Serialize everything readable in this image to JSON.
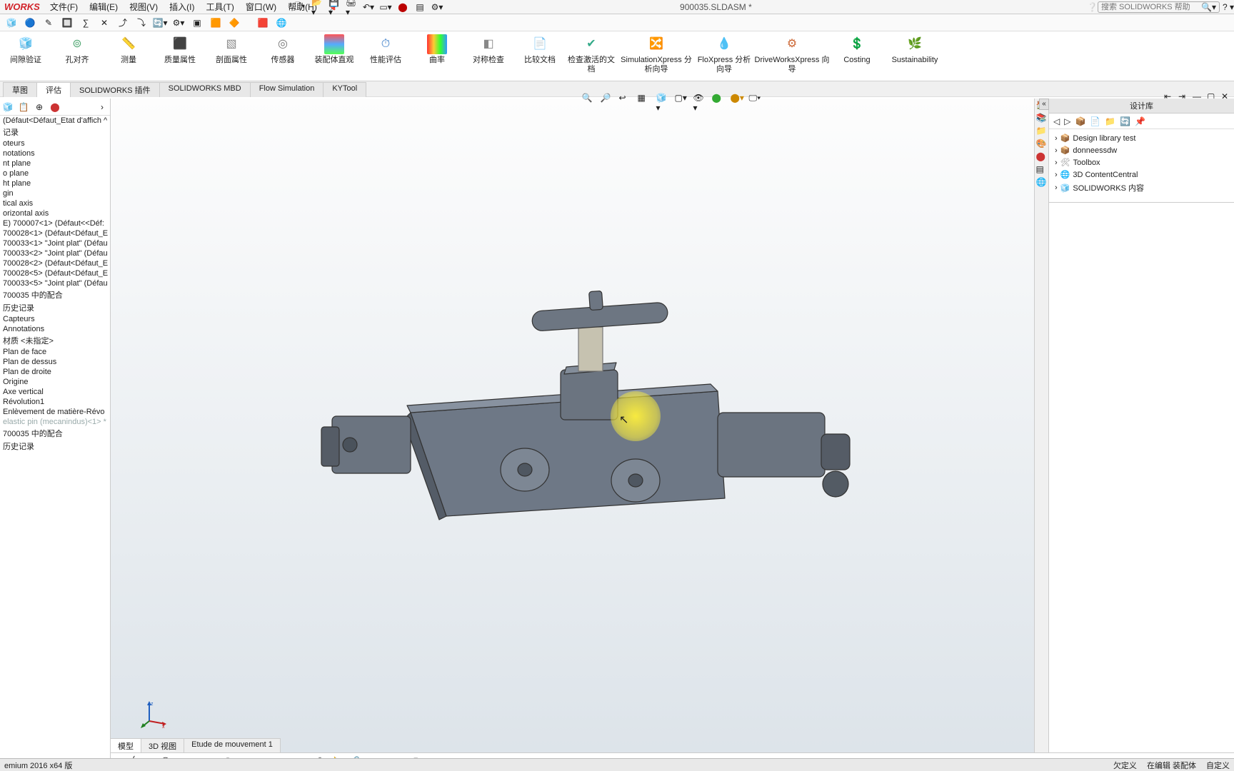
{
  "brand": "WORKS",
  "menus": [
    "文件(F)",
    "编辑(E)",
    "视图(V)",
    "插入(I)",
    "工具(T)",
    "窗口(W)",
    "帮助(H)"
  ],
  "doc_title": "900035.SLDASM *",
  "search_placeholder": "搜索 SOLIDWORKS 帮助",
  "ribbon": [
    {
      "label": "间隙验证"
    },
    {
      "label": "孔对齐"
    },
    {
      "label": "测量"
    },
    {
      "label": "质量属性"
    },
    {
      "label": "剖面属性"
    },
    {
      "label": "传感器"
    },
    {
      "label": "装配体直观"
    },
    {
      "label": "性能评估"
    },
    {
      "label": "曲率"
    },
    {
      "label": "对称检查"
    },
    {
      "label": "比较文档"
    },
    {
      "label": "检查激活的文档"
    },
    {
      "label": "SimulationXpress 分析向导"
    },
    {
      "label": "FloXpress 分析向导"
    },
    {
      "label": "DriveWorksXpress 向导"
    },
    {
      "label": "Costing"
    },
    {
      "label": "Sustainability"
    }
  ],
  "cmd_tabs": [
    "草图",
    "评估",
    "SOLIDWORKS 插件",
    "SOLIDWORKS MBD",
    "Flow Simulation",
    "KYTool"
  ],
  "feature_tree": [
    "(Défaut<Défaut_Etat d'affich ^",
    "记录",
    "oteurs",
    "notations",
    "nt plane",
    "o plane",
    "ht plane",
    "gin",
    "tical axis",
    "orizontal axis",
    "E) 700007<1> (Défaut<<Déf:",
    "700028<1> (Défaut<Défaut_E",
    "700033<1> \"Joint plat\" (Défau",
    "700033<2> \"Joint plat\" (Défau",
    "700028<2> (Défaut<Défaut_E",
    "700028<5> (Défaut<Défaut_E",
    "700033<5> \"Joint plat\" (Défau",
    "700035 中的配合",
    "历史记录",
    "Capteurs",
    "Annotations",
    "材质 <未指定>",
    "Plan de face",
    "Plan de dessus",
    "Plan de droite",
    "Origine",
    "Axe vertical",
    "Révolution1",
    "Enlèvement de matière-Révo",
    "elastic pin (mecanindus)<1> *",
    "700035 中的配合",
    "历史记录"
  ],
  "design_lib": {
    "title": "设计库",
    "items": [
      "Design library test",
      "donneessdw",
      "Toolbox",
      "3D ContentCentral",
      "SOLIDWORKS 内容"
    ]
  },
  "bottom_tabs": [
    "模型",
    "3D 视图",
    "Etude de mouvement 1"
  ],
  "status_left": "emium 2016 x64 版",
  "status_right": [
    "欠定义",
    "在编辑 装配体",
    "自定义"
  ]
}
